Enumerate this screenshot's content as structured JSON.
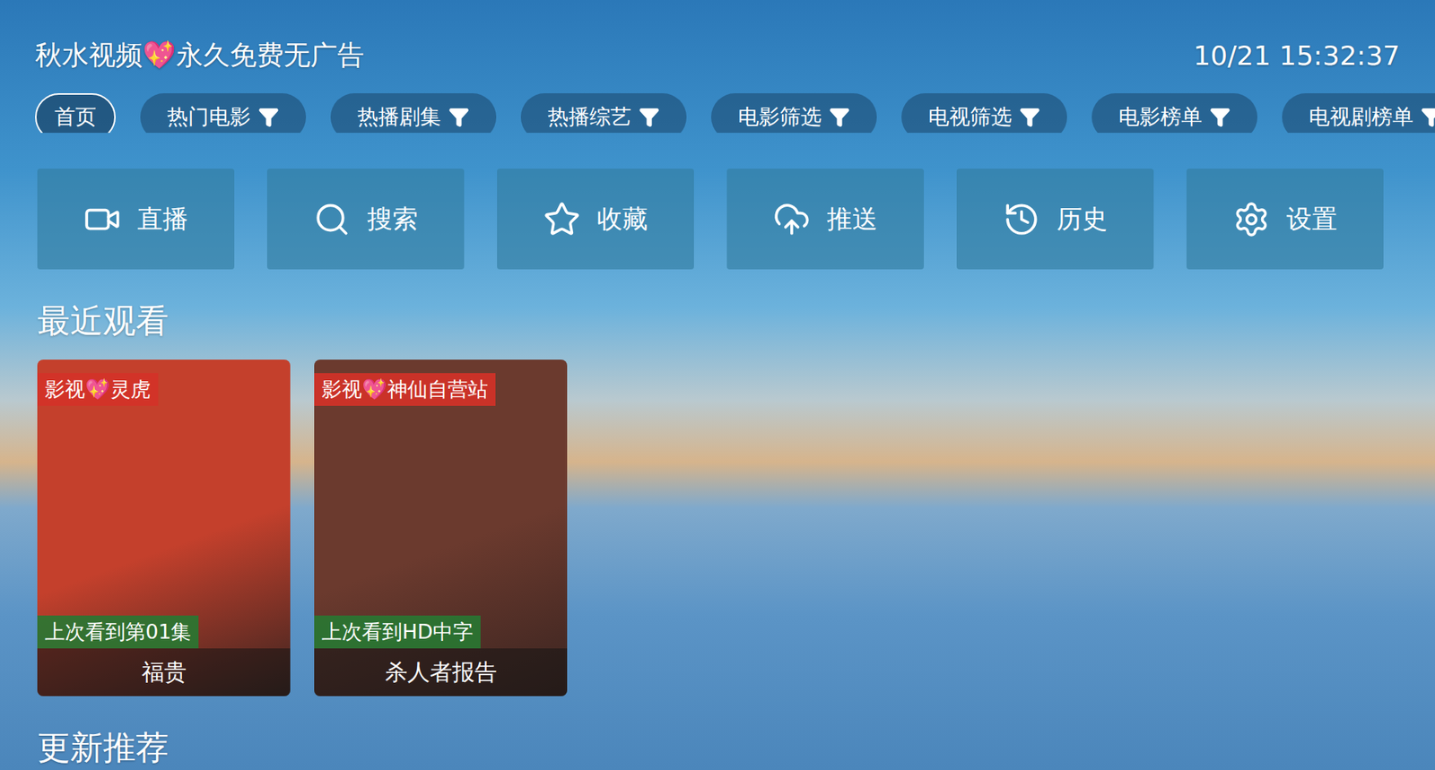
{
  "header": {
    "title": "秋水视频💖永久免费无广告",
    "time": "10/21 15:32:37"
  },
  "tabs": [
    {
      "label": "首页",
      "selected": true,
      "filter": false
    },
    {
      "label": "热门电影",
      "selected": false,
      "filter": true
    },
    {
      "label": "热播剧集",
      "selected": false,
      "filter": true
    },
    {
      "label": "热播综艺",
      "selected": false,
      "filter": true
    },
    {
      "label": "电影筛选",
      "selected": false,
      "filter": true
    },
    {
      "label": "电视筛选",
      "selected": false,
      "filter": true
    },
    {
      "label": "电影榜单",
      "selected": false,
      "filter": true
    },
    {
      "label": "电视剧榜单",
      "selected": false,
      "filter": true
    }
  ],
  "actions": [
    {
      "label": "直播"
    },
    {
      "label": "搜索"
    },
    {
      "label": "收藏"
    },
    {
      "label": "推送"
    },
    {
      "label": "历史"
    },
    {
      "label": "设置"
    }
  ],
  "recent": {
    "title": "最近观看",
    "items": [
      {
        "title": "福贵",
        "source": "影视💖灵虎",
        "progress": "上次看到第01集",
        "color": "#c4402c"
      },
      {
        "title": "杀人者报告",
        "source": "影视💖神仙自营站",
        "progress": "上次看到HD中字",
        "color": "#6b3a2e"
      }
    ]
  },
  "next_section": {
    "title": "更新推荐"
  }
}
